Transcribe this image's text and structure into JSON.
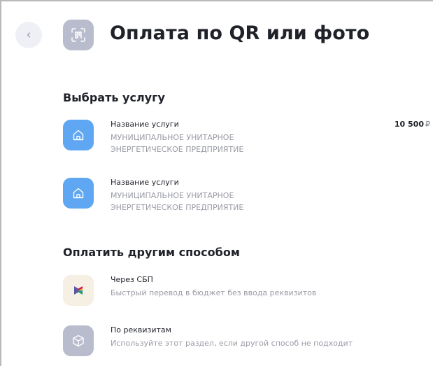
{
  "header": {
    "title": "Оплата по QR или фото",
    "back_icon": "chevron-left-icon",
    "scan_icon": "qr-scan-icon"
  },
  "services_section": {
    "title": "Выбрать услугу",
    "items": [
      {
        "name": "Название услуги",
        "org_line1": "МУНИЦИПАЛЬНОЕ УНИТАРНОЕ",
        "org_line2": "ЭНЕРГЕТИЧЕСКОЕ ПРЕДПРИЯТИЕ",
        "amount": "10 500",
        "currency": "₽",
        "icon": "house-icon"
      },
      {
        "name": "Название услуги",
        "org_line1": "МУНИЦИПАЛЬНОЕ УНИТАРНОЕ",
        "org_line2": "ЭНЕРГЕТИЧЕСКОЕ ПРЕДПРИЯТИЕ",
        "icon": "house-icon"
      }
    ]
  },
  "other_methods_section": {
    "title": "Оплатить другим способом",
    "items": [
      {
        "name": "Через СБП",
        "description": "Быстрый перевод в бюджет без ввода реквизитов",
        "icon": "sbp-logo-icon"
      },
      {
        "name": "По реквизитам",
        "description": "Используйте этот раздел, если другой способ не подходит",
        "icon": "box-icon"
      }
    ]
  },
  "colors": {
    "blue_icon_bg": "#5fa7f2",
    "gray_icon_bg": "#b9bccd",
    "sbp_icon_bg": "#f6efe3",
    "title_text": "#1f2229",
    "secondary_text": "#9a9ca5"
  }
}
